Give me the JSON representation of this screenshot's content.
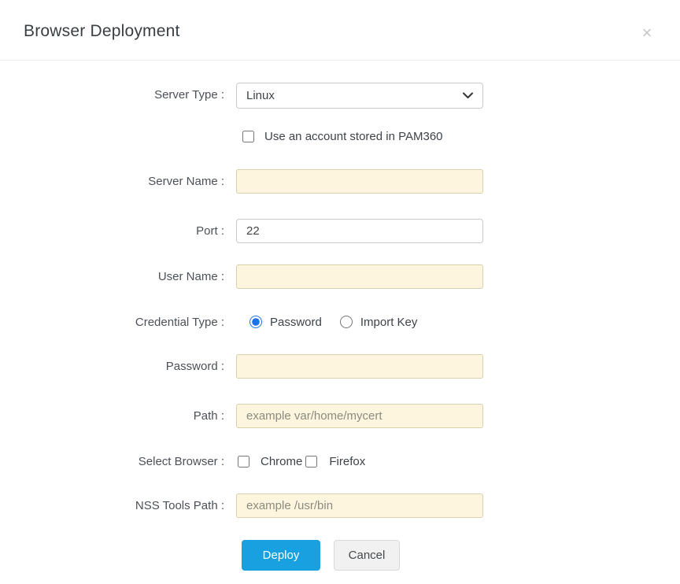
{
  "dialog": {
    "title": "Browser Deployment"
  },
  "icons": {
    "close": "×",
    "chevron_down": "chevron-down"
  },
  "colors": {
    "primary_button_blue": "#18a0e0",
    "radio_accent_blue": "#1a73e8",
    "highlight_field_bg": "#fdf5dd",
    "highlight_field_border": "#d8cfae"
  },
  "form": {
    "server_type": {
      "label": "Server Type :",
      "selected_option": "Linux"
    },
    "pam_account": {
      "label": "Use an account stored in PAM360",
      "checked": false
    },
    "server_name": {
      "label": "Server Name :",
      "value": ""
    },
    "port": {
      "label": "Port :",
      "value": "22"
    },
    "user_name": {
      "label": "User Name :",
      "value": ""
    },
    "credential_type": {
      "label": "Credential Type :",
      "options": [
        {
          "label": "Password",
          "selected": true
        },
        {
          "label": "Import Key",
          "selected": false
        }
      ]
    },
    "password": {
      "label": "Password :",
      "value": ""
    },
    "path": {
      "label": "Path :",
      "value": "",
      "placeholder": "example var/home/mycert"
    },
    "select_browser": {
      "label": "Select Browser :",
      "options": [
        {
          "label": "Chrome",
          "checked": false
        },
        {
          "label": "Firefox",
          "checked": false
        }
      ]
    },
    "nss_tools_path": {
      "label": "NSS Tools Path :",
      "value": "",
      "placeholder": "example /usr/bin"
    }
  },
  "footer": {
    "deploy_label": "Deploy",
    "cancel_label": "Cancel"
  }
}
